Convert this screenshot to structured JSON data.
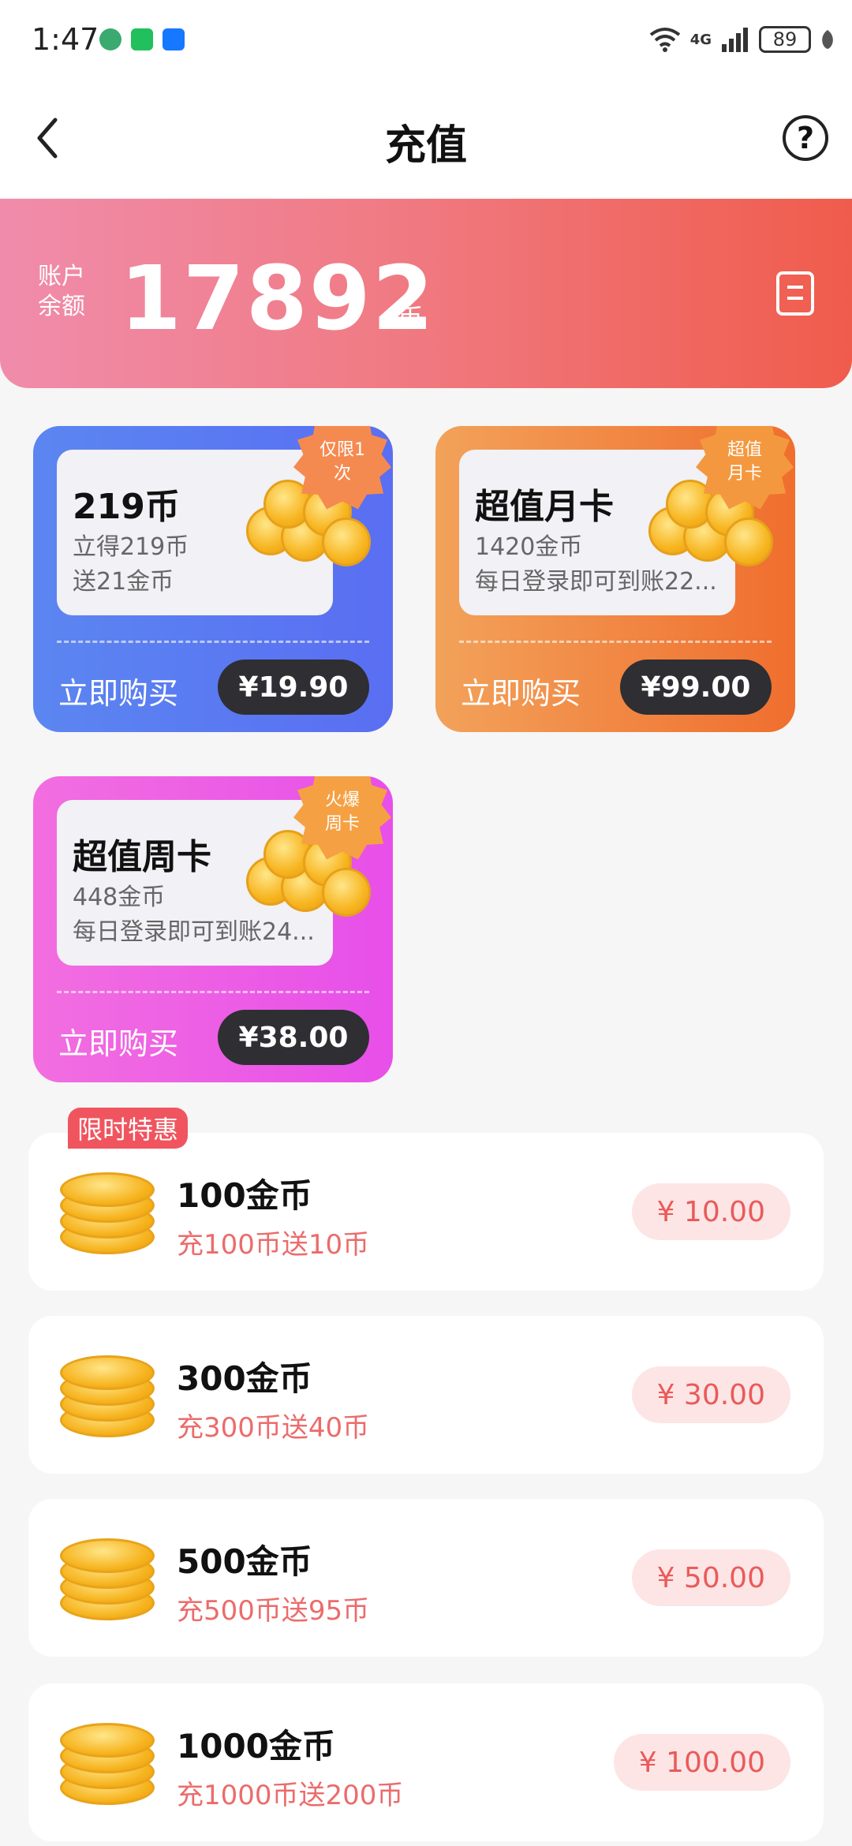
{
  "status_bar": {
    "time": "1:47",
    "network": "4G",
    "battery": "89"
  },
  "header": {
    "title": "充值"
  },
  "balance": {
    "label": "账户余额",
    "value": "17892",
    "unit": "币"
  },
  "packages": [
    {
      "title": "219币",
      "line1": "立得219币",
      "line2": "送21金币",
      "badge": "仅限1次",
      "buy_label": "立即购买",
      "price": "¥19.90",
      "color": "#5a78f2"
    },
    {
      "title": "超值月卡",
      "line1": "1420金币",
      "line2": "每日登录即可到账22...",
      "badge": "超值月卡",
      "buy_label": "立即购买",
      "price": "¥99.00",
      "color": "#f28a3e"
    },
    {
      "title": "超值周卡",
      "line1": "448金币",
      "line2": "每日登录即可到账24...",
      "badge": "火爆周卡",
      "buy_label": "立即购买",
      "price": "¥38.00",
      "color": "#ec5ee6"
    }
  ],
  "promo_tag": "限时特惠",
  "coin_items": [
    {
      "title": "100金币",
      "subtitle": "充100币送10币",
      "price": "¥ 10.00"
    },
    {
      "title": "300金币",
      "subtitle": "充300币送40币",
      "price": "¥ 30.00"
    },
    {
      "title": "500金币",
      "subtitle": "充500币送95币",
      "price": "¥ 50.00"
    },
    {
      "title": "1000金币",
      "subtitle": "充1000币送200币",
      "price": "¥ 100.00"
    }
  ]
}
